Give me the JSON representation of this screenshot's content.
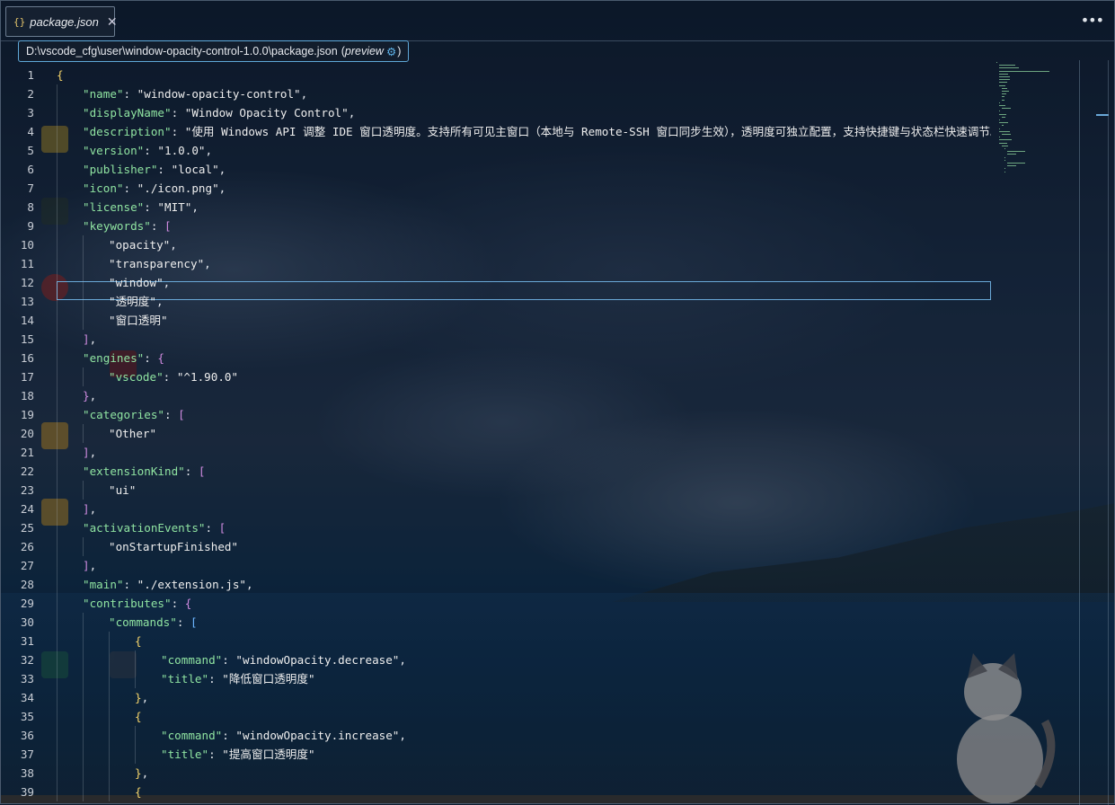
{
  "tab": {
    "icon": "{}",
    "filename": "package.json",
    "close": "✕"
  },
  "toolbar": {
    "more": "•••"
  },
  "path_tooltip": {
    "path": "D:\\vscode_cfg\\user\\window-opacity-control-1.0.0\\package.json",
    "preview_open": "(",
    "preview_label": "preview",
    "preview_close": ")"
  },
  "lines": [
    {
      "n": "1",
      "indent": 0,
      "tokens": [
        {
          "t": "{",
          "c": "br"
        }
      ]
    },
    {
      "n": "2",
      "indent": 1,
      "tokens": [
        {
          "t": "\"name\"",
          "c": "k"
        },
        {
          "t": ": ",
          "c": "p"
        },
        {
          "t": "\"window-opacity-control\"",
          "c": "s"
        },
        {
          "t": ",",
          "c": "p"
        }
      ]
    },
    {
      "n": "3",
      "indent": 1,
      "tokens": [
        {
          "t": "\"displayName\"",
          "c": "k"
        },
        {
          "t": ": ",
          "c": "p"
        },
        {
          "t": "\"Window Opacity Control\"",
          "c": "s"
        },
        {
          "t": ",",
          "c": "p"
        }
      ]
    },
    {
      "n": "4",
      "indent": 1,
      "tokens": [
        {
          "t": "\"description\"",
          "c": "k"
        },
        {
          "t": ": ",
          "c": "p"
        },
        {
          "t": "\"使用 Windows API 调整 IDE 窗口透明度。支持所有可见主窗口（本地与 Remote-SSH 窗口同步生效），透明度可独立配置，支持快捷键与状态栏快速调节。\"",
          "c": "s"
        },
        {
          "t": ",",
          "c": "p"
        }
      ]
    },
    {
      "n": "5",
      "indent": 1,
      "tokens": [
        {
          "t": "\"version\"",
          "c": "k"
        },
        {
          "t": ": ",
          "c": "p"
        },
        {
          "t": "\"1.0.0\"",
          "c": "s"
        },
        {
          "t": ",",
          "c": "p"
        }
      ]
    },
    {
      "n": "6",
      "indent": 1,
      "tokens": [
        {
          "t": "\"publisher\"",
          "c": "k"
        },
        {
          "t": ": ",
          "c": "p"
        },
        {
          "t": "\"local\"",
          "c": "s"
        },
        {
          "t": ",",
          "c": "p"
        }
      ]
    },
    {
      "n": "7",
      "indent": 1,
      "tokens": [
        {
          "t": "\"icon\"",
          "c": "k"
        },
        {
          "t": ": ",
          "c": "p"
        },
        {
          "t": "\"./icon.png\"",
          "c": "s"
        },
        {
          "t": ",",
          "c": "p"
        }
      ]
    },
    {
      "n": "8",
      "indent": 1,
      "tokens": [
        {
          "t": "\"license\"",
          "c": "k"
        },
        {
          "t": ": ",
          "c": "p"
        },
        {
          "t": "\"MIT\"",
          "c": "s"
        },
        {
          "t": ",",
          "c": "p"
        }
      ]
    },
    {
      "n": "9",
      "indent": 1,
      "tokens": [
        {
          "t": "\"keywords\"",
          "c": "k"
        },
        {
          "t": ": ",
          "c": "p"
        },
        {
          "t": "[",
          "c": "br2"
        }
      ]
    },
    {
      "n": "10",
      "indent": 2,
      "tokens": [
        {
          "t": "\"opacity\"",
          "c": "s"
        },
        {
          "t": ",",
          "c": "p"
        }
      ]
    },
    {
      "n": "11",
      "indent": 2,
      "tokens": [
        {
          "t": "\"transparency\"",
          "c": "s"
        },
        {
          "t": ",",
          "c": "p"
        }
      ]
    },
    {
      "n": "12",
      "indent": 2,
      "tokens": [
        {
          "t": "\"window\"",
          "c": "s"
        },
        {
          "t": ",",
          "c": "p"
        }
      ]
    },
    {
      "n": "13",
      "indent": 2,
      "tokens": [
        {
          "t": "\"透明度\"",
          "c": "s"
        },
        {
          "t": ",",
          "c": "p"
        }
      ]
    },
    {
      "n": "14",
      "indent": 2,
      "tokens": [
        {
          "t": "\"窗口透明\"",
          "c": "s"
        }
      ]
    },
    {
      "n": "15",
      "indent": 1,
      "tokens": [
        {
          "t": "]",
          "c": "br2"
        },
        {
          "t": ",",
          "c": "p"
        }
      ]
    },
    {
      "n": "16",
      "indent": 1,
      "tokens": [
        {
          "t": "\"engines\"",
          "c": "k"
        },
        {
          "t": ": ",
          "c": "p"
        },
        {
          "t": "{",
          "c": "br2"
        }
      ]
    },
    {
      "n": "17",
      "indent": 2,
      "tokens": [
        {
          "t": "\"vscode\"",
          "c": "k"
        },
        {
          "t": ": ",
          "c": "p"
        },
        {
          "t": "\"^1.90.0\"",
          "c": "s"
        }
      ]
    },
    {
      "n": "18",
      "indent": 1,
      "tokens": [
        {
          "t": "}",
          "c": "br2"
        },
        {
          "t": ",",
          "c": "p"
        }
      ]
    },
    {
      "n": "19",
      "indent": 1,
      "tokens": [
        {
          "t": "\"categories\"",
          "c": "k"
        },
        {
          "t": ": ",
          "c": "p"
        },
        {
          "t": "[",
          "c": "br2"
        }
      ]
    },
    {
      "n": "20",
      "indent": 2,
      "tokens": [
        {
          "t": "\"Other\"",
          "c": "s"
        }
      ]
    },
    {
      "n": "21",
      "indent": 1,
      "tokens": [
        {
          "t": "]",
          "c": "br2"
        },
        {
          "t": ",",
          "c": "p"
        }
      ]
    },
    {
      "n": "22",
      "indent": 1,
      "tokens": [
        {
          "t": "\"extensionKind\"",
          "c": "k"
        },
        {
          "t": ": ",
          "c": "p"
        },
        {
          "t": "[",
          "c": "br2"
        }
      ]
    },
    {
      "n": "23",
      "indent": 2,
      "tokens": [
        {
          "t": "\"ui\"",
          "c": "s"
        }
      ]
    },
    {
      "n": "24",
      "indent": 1,
      "tokens": [
        {
          "t": "]",
          "c": "br2"
        },
        {
          "t": ",",
          "c": "p"
        }
      ]
    },
    {
      "n": "25",
      "indent": 1,
      "tokens": [
        {
          "t": "\"activationEvents\"",
          "c": "k"
        },
        {
          "t": ": ",
          "c": "p"
        },
        {
          "t": "[",
          "c": "br2"
        }
      ]
    },
    {
      "n": "26",
      "indent": 2,
      "tokens": [
        {
          "t": "\"onStartupFinished\"",
          "c": "s"
        }
      ]
    },
    {
      "n": "27",
      "indent": 1,
      "tokens": [
        {
          "t": "]",
          "c": "br2"
        },
        {
          "t": ",",
          "c": "p"
        }
      ]
    },
    {
      "n": "28",
      "indent": 1,
      "tokens": [
        {
          "t": "\"main\"",
          "c": "k"
        },
        {
          "t": ": ",
          "c": "p"
        },
        {
          "t": "\"./extension.js\"",
          "c": "s"
        },
        {
          "t": ",",
          "c": "p"
        }
      ]
    },
    {
      "n": "29",
      "indent": 1,
      "tokens": [
        {
          "t": "\"contributes\"",
          "c": "k"
        },
        {
          "t": ": ",
          "c": "p"
        },
        {
          "t": "{",
          "c": "br2"
        }
      ]
    },
    {
      "n": "30",
      "indent": 2,
      "tokens": [
        {
          "t": "\"commands\"",
          "c": "k"
        },
        {
          "t": ": ",
          "c": "p"
        },
        {
          "t": "[",
          "c": "br3"
        }
      ]
    },
    {
      "n": "31",
      "indent": 3,
      "tokens": [
        {
          "t": "{",
          "c": "br"
        }
      ]
    },
    {
      "n": "32",
      "indent": 4,
      "tokens": [
        {
          "t": "\"command\"",
          "c": "k"
        },
        {
          "t": ": ",
          "c": "p"
        },
        {
          "t": "\"windowOpacity.decrease\"",
          "c": "s"
        },
        {
          "t": ",",
          "c": "p"
        }
      ]
    },
    {
      "n": "33",
      "indent": 4,
      "tokens": [
        {
          "t": "\"title\"",
          "c": "k"
        },
        {
          "t": ": ",
          "c": "p"
        },
        {
          "t": "\"降低窗口透明度\"",
          "c": "s"
        }
      ]
    },
    {
      "n": "34",
      "indent": 3,
      "tokens": [
        {
          "t": "}",
          "c": "br"
        },
        {
          "t": ",",
          "c": "p"
        }
      ]
    },
    {
      "n": "35",
      "indent": 3,
      "tokens": [
        {
          "t": "{",
          "c": "br"
        }
      ]
    },
    {
      "n": "36",
      "indent": 4,
      "tokens": [
        {
          "t": "\"command\"",
          "c": "k"
        },
        {
          "t": ": ",
          "c": "p"
        },
        {
          "t": "\"windowOpacity.increase\"",
          "c": "s"
        },
        {
          "t": ",",
          "c": "p"
        }
      ]
    },
    {
      "n": "37",
      "indent": 4,
      "tokens": [
        {
          "t": "\"title\"",
          "c": "k"
        },
        {
          "t": ": ",
          "c": "p"
        },
        {
          "t": "\"提高窗口透明度\"",
          "c": "s"
        }
      ]
    },
    {
      "n": "38",
      "indent": 3,
      "tokens": [
        {
          "t": "}",
          "c": "br"
        },
        {
          "t": ",",
          "c": "p"
        }
      ]
    },
    {
      "n": "39",
      "indent": 3,
      "tokens": [
        {
          "t": "{",
          "c": "br"
        }
      ]
    }
  ],
  "active_line": "9",
  "colors": {
    "key": "#8fe3a1",
    "string": "#eeeeee",
    "bracket_level1": "#f5d46a",
    "bracket_level2": "#cf8be0",
    "bracket_level3": "#6cb6ff",
    "accent": "#5fa8d8"
  }
}
